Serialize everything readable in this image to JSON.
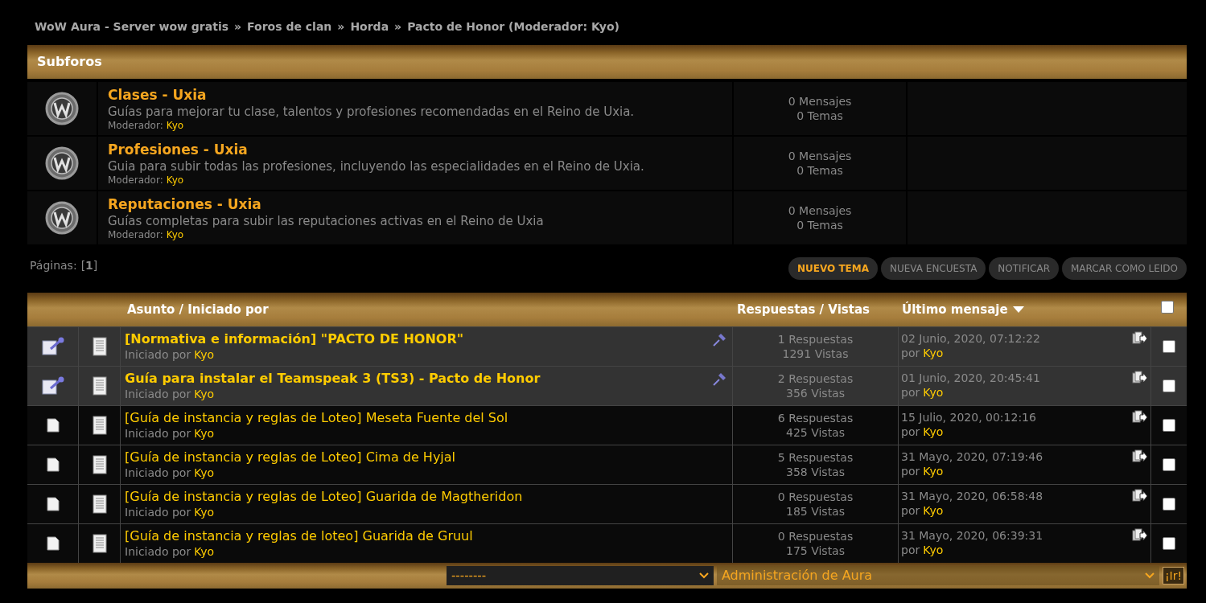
{
  "breadcrumb": [
    "WoW Aura - Server wow gratis",
    "Foros de clan",
    "Horda",
    "Pacto de Honor (Moderador: Kyo)"
  ],
  "breadcrumb_separator": "»",
  "subforums": {
    "title": "Subforos",
    "boards": [
      {
        "name": "Clases - Uxia",
        "description": "Guías para mejorar tu clase, talentos y profesiones recomendadas en el Reino de Uxia.",
        "moderator_label": "Moderador:",
        "moderator": "Kyo",
        "posts": "0 Mensajes",
        "topics": "0 Temas"
      },
      {
        "name": "Profesiones - Uxia",
        "description": "Guia para subir todas las profesiones, incluyendo las especialidades en el Reino de Uxia.",
        "moderator_label": "Moderador:",
        "moderator": "Kyo",
        "posts": "0 Mensajes",
        "topics": "0 Temas"
      },
      {
        "name": "Reputaciones - Uxia",
        "description": "Guías completas para subir las reputaciones activas en el Reino de Uxia",
        "moderator_label": "Moderador:",
        "moderator": "Kyo",
        "posts": "0 Mensajes",
        "topics": "0 Temas"
      }
    ]
  },
  "pages": {
    "label": "Páginas:",
    "current": "[**1**]"
  },
  "buttons": [
    {
      "label": "NUEVO TEMA",
      "selected": true
    },
    {
      "label": "NUEVA ENCUESTA",
      "selected": false
    },
    {
      "label": "NOTIFICAR",
      "selected": false
    },
    {
      "label": "MARCAR COMO LEIDO",
      "selected": false
    }
  ],
  "topics": {
    "columns": {
      "subject": "Asunto / Iniciado por",
      "stats": "Respuestas / Vistas",
      "last": "Último mensaje",
      "select_all": false
    },
    "rows": [
      {
        "title": "[Normativa e información] \"PACTO DE HONOR\"",
        "started_label": "Iniciado por",
        "author": "Kyo",
        "sticky": true,
        "replies": "1 Respuestas",
        "views": "1291 Vistas",
        "last_date": "02 Junio, 2020, 07:12:22",
        "last_by": "por",
        "last_author": "Kyo",
        "checked": false
      },
      {
        "title": "Guía para instalar el Teamspeak 3 (TS3) - Pacto de Honor",
        "started_label": "Iniciado por",
        "author": "Kyo",
        "sticky": true,
        "replies": "2 Respuestas",
        "views": "356 Vistas",
        "last_date": "01 Junio, 2020, 20:45:41",
        "last_by": "por",
        "last_author": "Kyo",
        "checked": false
      },
      {
        "title": "[Guía de instancia y reglas de Loteo] Meseta Fuente del Sol",
        "started_label": "Iniciado por",
        "author": "Kyo",
        "sticky": false,
        "replies": "6 Respuestas",
        "views": "425 Vistas",
        "last_date": "15 Julio, 2020, 00:12:16",
        "last_by": "por",
        "last_author": "Kyo",
        "checked": false
      },
      {
        "title": "[Guía de instancia y reglas de Loteo] Cima de Hyjal",
        "started_label": "Iniciado por",
        "author": "Kyo",
        "sticky": false,
        "replies": "5 Respuestas",
        "views": "358 Vistas",
        "last_date": "31 Mayo, 2020, 07:19:46",
        "last_by": "por",
        "last_author": "Kyo",
        "checked": false
      },
      {
        "title": "[Guía de instancia y reglas de Loteo] Guarida de Magtheridon",
        "started_label": "Iniciado por",
        "author": "Kyo",
        "sticky": false,
        "replies": "0 Respuestas",
        "views": "185 Vistas",
        "last_date": "31 Mayo, 2020, 06:58:48",
        "last_by": "por",
        "last_author": "Kyo",
        "checked": false
      },
      {
        "title": "[Guía de instancia y reglas de loteo] Guarida de Gruul",
        "started_label": "Iniciado por",
        "author": "Kyo",
        "sticky": false,
        "replies": "0 Respuestas",
        "views": "175 Vistas",
        "last_date": "31 Mayo, 2020, 06:39:31",
        "last_by": "por",
        "last_author": "Kyo",
        "checked": false
      }
    ]
  },
  "footer": {
    "action_select": "--------",
    "board_select": "Administración de Aura",
    "go_button": "¡Ir!"
  }
}
